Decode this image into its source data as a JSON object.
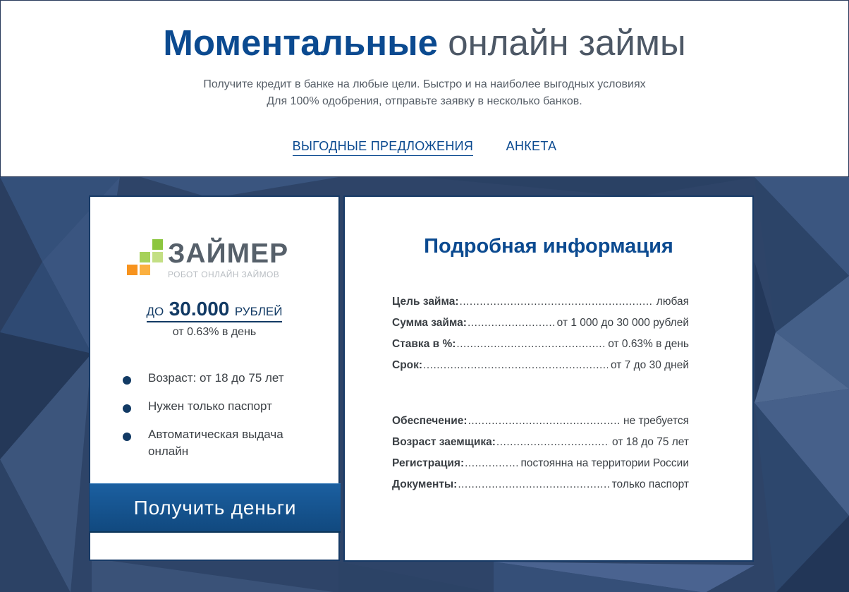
{
  "header": {
    "title_bold": "Моментальные",
    "title_light": "онлайн займы",
    "subtitle_line1": "Получите кредит в банке на любые цели. Быстро и на наиболее выгодных условиях",
    "subtitle_line2": "Для 100% одобрения, отправьте заявку в несколько банков.",
    "nav": [
      {
        "label": "ВЫГОДНЫЕ ПРЕДЛОЖЕНИЯ",
        "active": true
      },
      {
        "label": "АНКЕТА",
        "active": false
      }
    ]
  },
  "offer": {
    "logo_name": "ЗАЙМЕР",
    "logo_tagline": "РОБОТ ОНЛАЙН ЗАЙМОВ",
    "amount_prefix": "ДО",
    "amount_value": "30.000",
    "amount_suffix": "РУБЛЕЙ",
    "rate": "от 0.63% в день",
    "features": [
      "Возраст: от 18 до 75 лет",
      "Нужен только паспорт",
      "Автоматическая выдача онлайн"
    ],
    "cta_label": "Получить деньги"
  },
  "details": {
    "title": "Подробная информация",
    "group1": [
      {
        "label": "Цель займа:",
        "value": "любая"
      },
      {
        "label": "Сумма займа:",
        "value": "от 1 000 до 30 000 рублей"
      },
      {
        "label": "Ставка в %:",
        "value": "от 0.63% в день"
      },
      {
        "label": "Срок:",
        "value": "от 7 до 30 дней"
      }
    ],
    "group2": [
      {
        "label": "Обеспечение:",
        "value": "не требуется"
      },
      {
        "label": "Возраст заемщика:",
        "value": "от 18 до 75 лет"
      },
      {
        "label": "Регистрация:",
        "value": "постоянна на территории России"
      },
      {
        "label": "Документы:",
        "value": "только паспорт"
      }
    ]
  },
  "colors": {
    "brand_blue": "#0b4a90",
    "dark_navy": "#123a64",
    "background": "#2e4468",
    "logo_green": "#8cc63f",
    "logo_orange": "#f7931e"
  }
}
